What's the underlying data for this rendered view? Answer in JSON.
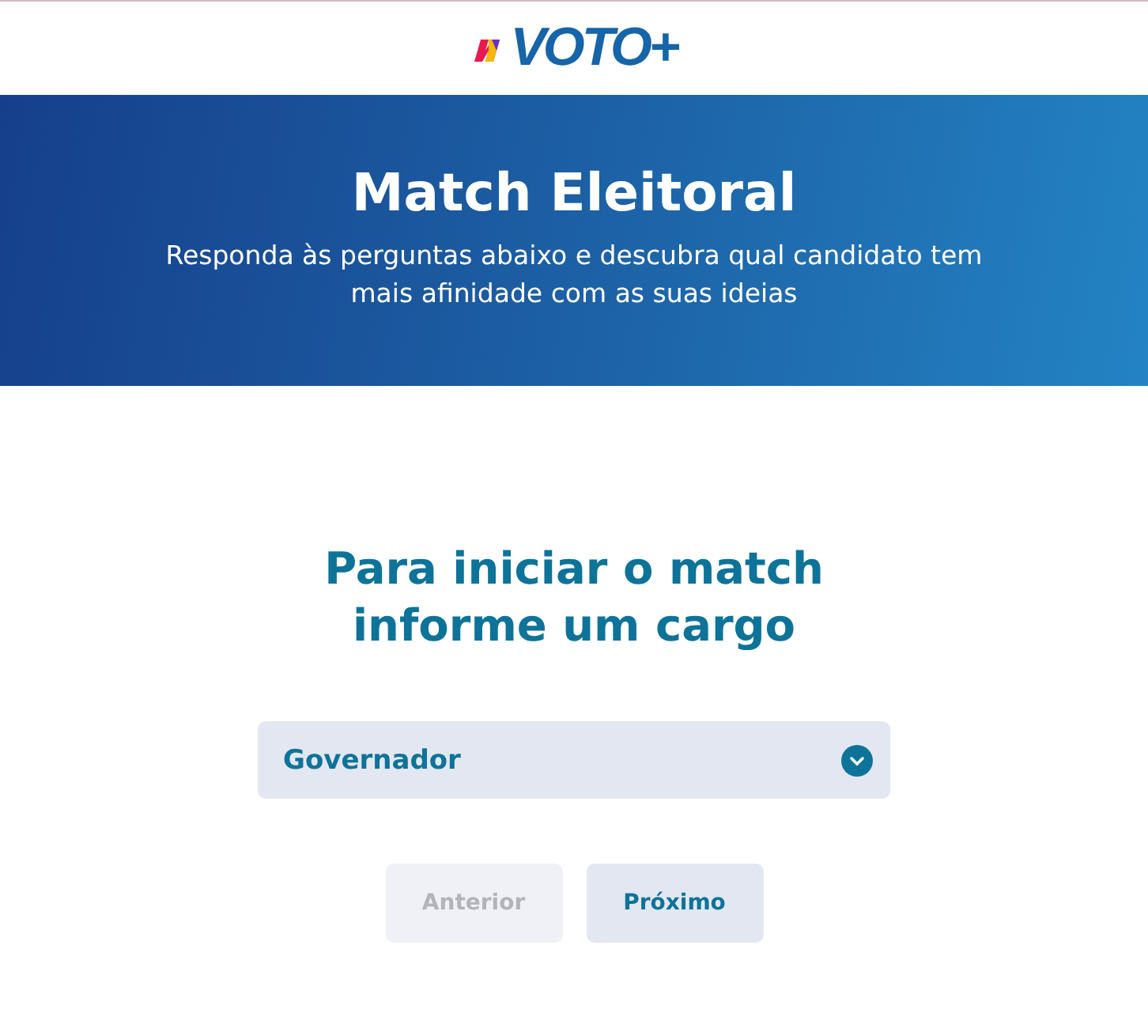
{
  "header": {
    "logo": "VOTO+"
  },
  "banner": {
    "title": "Match Eleitoral",
    "subtitle": "Responda às perguntas abaixo e descubra qual candidato tem mais afinidade com as suas ideias"
  },
  "prompt": {
    "heading": "Para iniciar o match informe um cargo"
  },
  "select": {
    "value": "Governador"
  },
  "buttons": [
    {
      "label": "Anterior",
      "disabled": true
    },
    {
      "label": "Próximo",
      "disabled": false
    }
  ]
}
